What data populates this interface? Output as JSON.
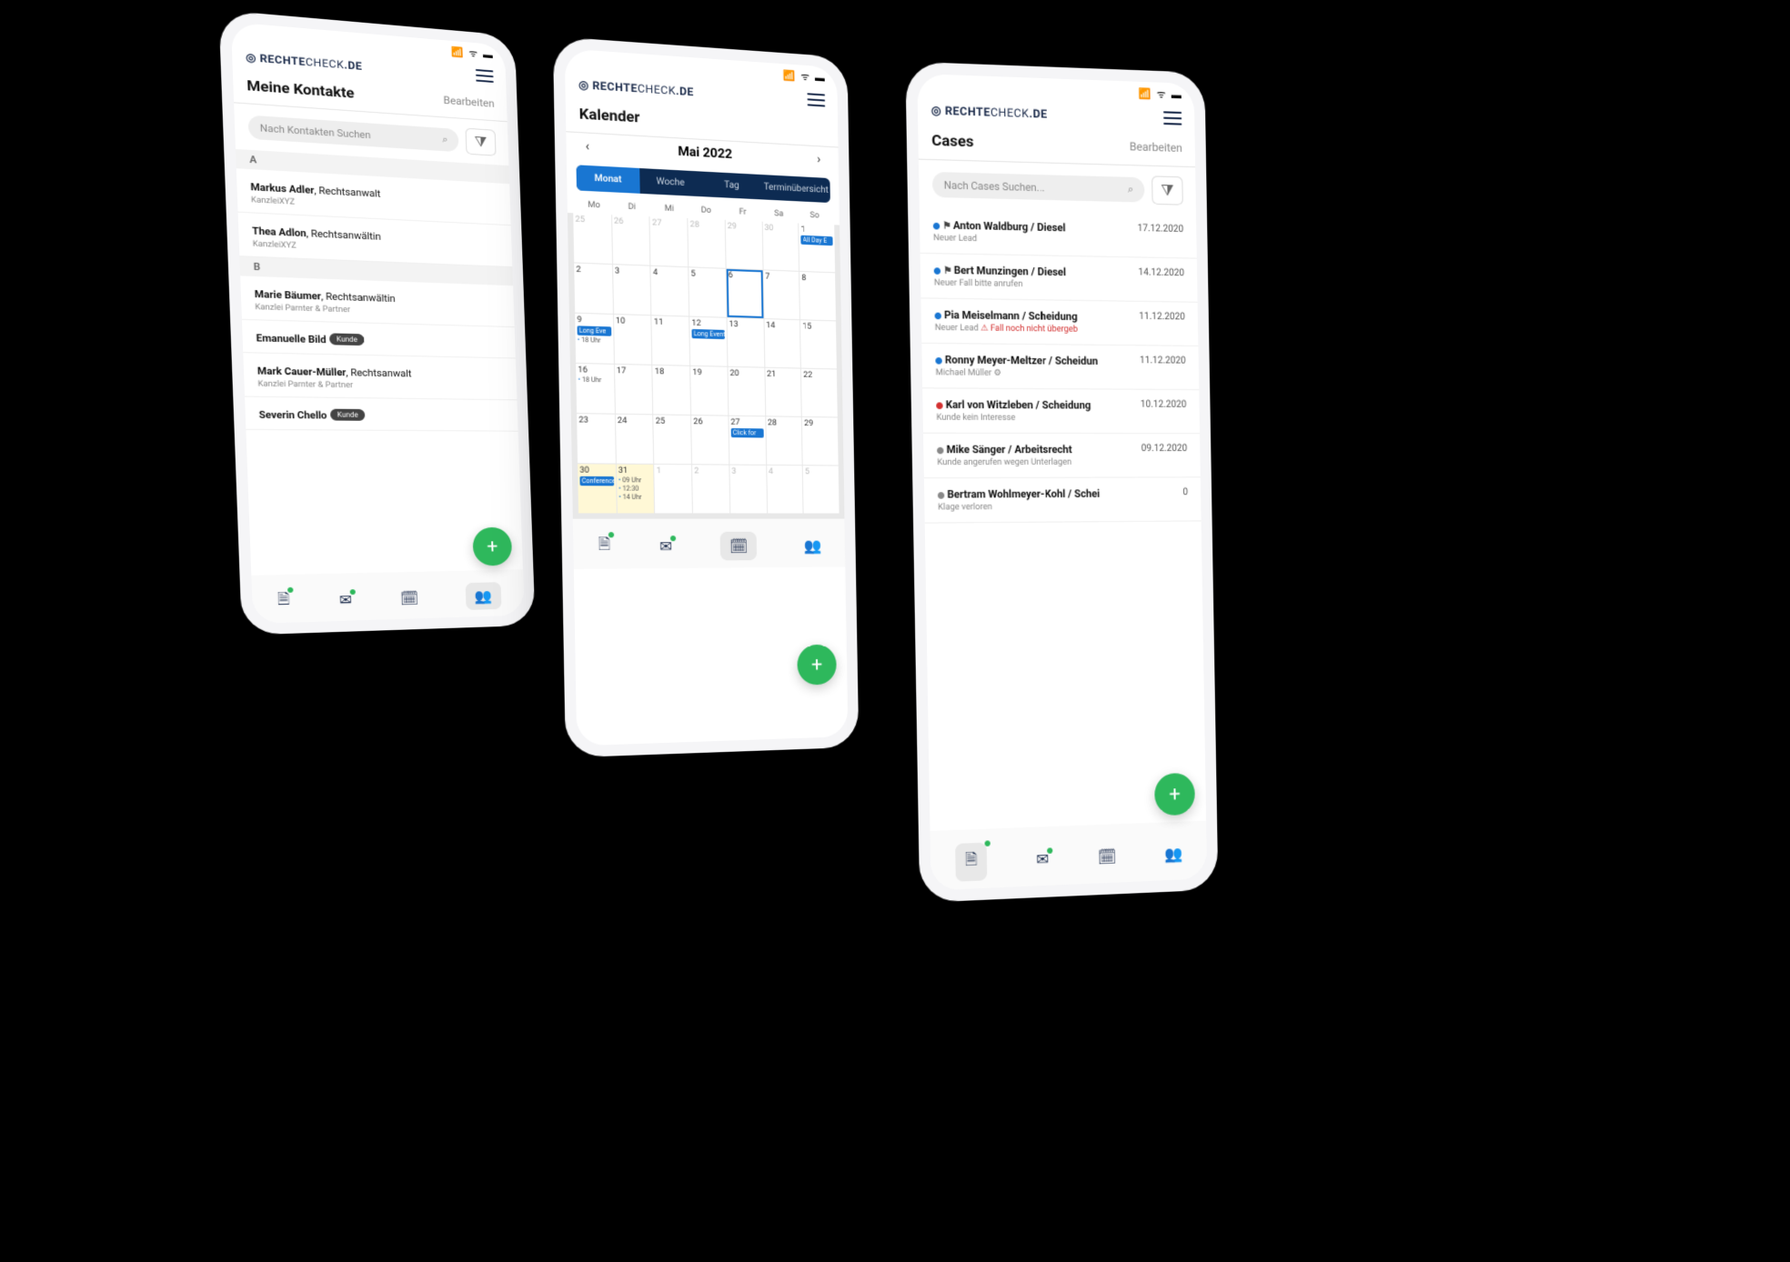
{
  "brand": {
    "pre": "RECHTE",
    "mid": "CHECK",
    "suf": ".DE"
  },
  "contacts": {
    "title": "Meine Kontakte",
    "edit": "Bearbeiten",
    "searchPlaceholder": "Nach Kontakten Suchen",
    "badge_kunde": "Kunde",
    "sections": [
      {
        "letter": "A",
        "items": [
          {
            "name": "Markus Adler",
            "role": ", Rechtsanwalt",
            "sub": "KanzleiXYZ"
          },
          {
            "name": "Thea Adlon",
            "role": ", Rechtsanwältin",
            "sub": "KanzleiXYZ"
          }
        ]
      },
      {
        "letter": "B",
        "items": [
          {
            "name": "Marie Bäumer",
            "role": ", Rechtsanwältin",
            "sub": "Kanzlei Parnter & Partner"
          },
          {
            "name": "Emanuelle Bild",
            "role": "",
            "sub": "",
            "badge": true
          },
          {
            "name": "Mark Cauer-Müller",
            "role": ", Rechtsanwalt",
            "sub": "Kanzlei Parnter & Partner"
          },
          {
            "name": "Severin Chello",
            "role": "",
            "sub": "",
            "badge": true
          }
        ]
      }
    ]
  },
  "calendar": {
    "title": "Kalender",
    "month": "Mai 2022",
    "views": [
      "Monat",
      "Woche",
      "Tag",
      "Terminübersicht"
    ],
    "activeView": 0,
    "weekdays": [
      "Mo",
      "Di",
      "Mi",
      "Do",
      "Fr",
      "Sa",
      "So"
    ],
    "days": [
      {
        "n": "25",
        "muted": true
      },
      {
        "n": "26",
        "muted": true
      },
      {
        "n": "27",
        "muted": true
      },
      {
        "n": "28",
        "muted": true
      },
      {
        "n": "29",
        "muted": true
      },
      {
        "n": "30",
        "muted": true
      },
      {
        "n": "1",
        "events": [
          {
            "t": "All Day E",
            "bar": true
          }
        ]
      },
      {
        "n": "2"
      },
      {
        "n": "3"
      },
      {
        "n": "4"
      },
      {
        "n": "5"
      },
      {
        "n": "6",
        "today": true
      },
      {
        "n": "7"
      },
      {
        "n": "8"
      },
      {
        "n": "9",
        "events": [
          {
            "t": "Long Eve",
            "bar": true
          },
          {
            "t": "18 Uhr",
            "dot": true
          }
        ]
      },
      {
        "n": "10"
      },
      {
        "n": "11"
      },
      {
        "n": "12",
        "events": [
          {
            "t": "Long Event",
            "bar": true
          }
        ]
      },
      {
        "n": "13"
      },
      {
        "n": "14"
      },
      {
        "n": "15"
      },
      {
        "n": "16",
        "events": [
          {
            "t": "18 Uhr",
            "dot": true
          }
        ]
      },
      {
        "n": "17"
      },
      {
        "n": "18"
      },
      {
        "n": "19"
      },
      {
        "n": "20"
      },
      {
        "n": "21"
      },
      {
        "n": "22"
      },
      {
        "n": "23"
      },
      {
        "n": "24"
      },
      {
        "n": "25"
      },
      {
        "n": "26"
      },
      {
        "n": "27",
        "events": [
          {
            "t": "Click for",
            "bar": true
          }
        ]
      },
      {
        "n": "28"
      },
      {
        "n": "29"
      },
      {
        "n": "30",
        "events": [
          {
            "t": "Conference",
            "bar": true
          }
        ],
        "hi": true
      },
      {
        "n": "31",
        "events": [
          {
            "t": "09 Uhr",
            "dot": true
          },
          {
            "t": "12:30",
            "dot": true
          },
          {
            "t": "14 Uhr",
            "dot": true
          }
        ],
        "hi": true
      },
      {
        "n": "1",
        "muted": true
      },
      {
        "n": "2",
        "muted": true
      },
      {
        "n": "3",
        "muted": true
      },
      {
        "n": "4",
        "muted": true
      },
      {
        "n": "5",
        "muted": true
      }
    ]
  },
  "cases": {
    "title": "Cases",
    "edit": "Bearbeiten",
    "searchPlaceholder": "Nach Cases Suchen...",
    "items": [
      {
        "status": "blue",
        "flag": true,
        "title": "Anton Waldburg  /  Diesel",
        "sub": "Neuer Lead",
        "date": "17.12.2020"
      },
      {
        "status": "blue",
        "flag": true,
        "title": "Bert Munzingen  /  Diesel",
        "sub": "Neuer Fall bitte anrufen",
        "date": "14.12.2020"
      },
      {
        "status": "blue",
        "title": "Pia Meiselmann  /  Scheidung",
        "sub": "Neuer Lead",
        "warn": "Fall noch nicht übergeb",
        "date": "11.12.2020"
      },
      {
        "status": "blue",
        "title": "Ronny Meyer-Meltzer  /  Scheidun",
        "sub": "Michael Müller ⚙",
        "date": "11.12.2020"
      },
      {
        "status": "red",
        "title": "Karl von Witzleben  /  Scheidung",
        "sub": "Kunde kein Interesse",
        "date": "10.12.2020"
      },
      {
        "status": "gray",
        "title": "Mike Sänger  /  Arbeitsrecht",
        "sub": "Kunde angerufen wegen Unterlagen",
        "date": "09.12.2020"
      },
      {
        "status": "gray",
        "title": "Bertram Wohlmeyer-Kohl  /  Schei",
        "sub": "Klage verloren",
        "date": "0"
      }
    ]
  }
}
